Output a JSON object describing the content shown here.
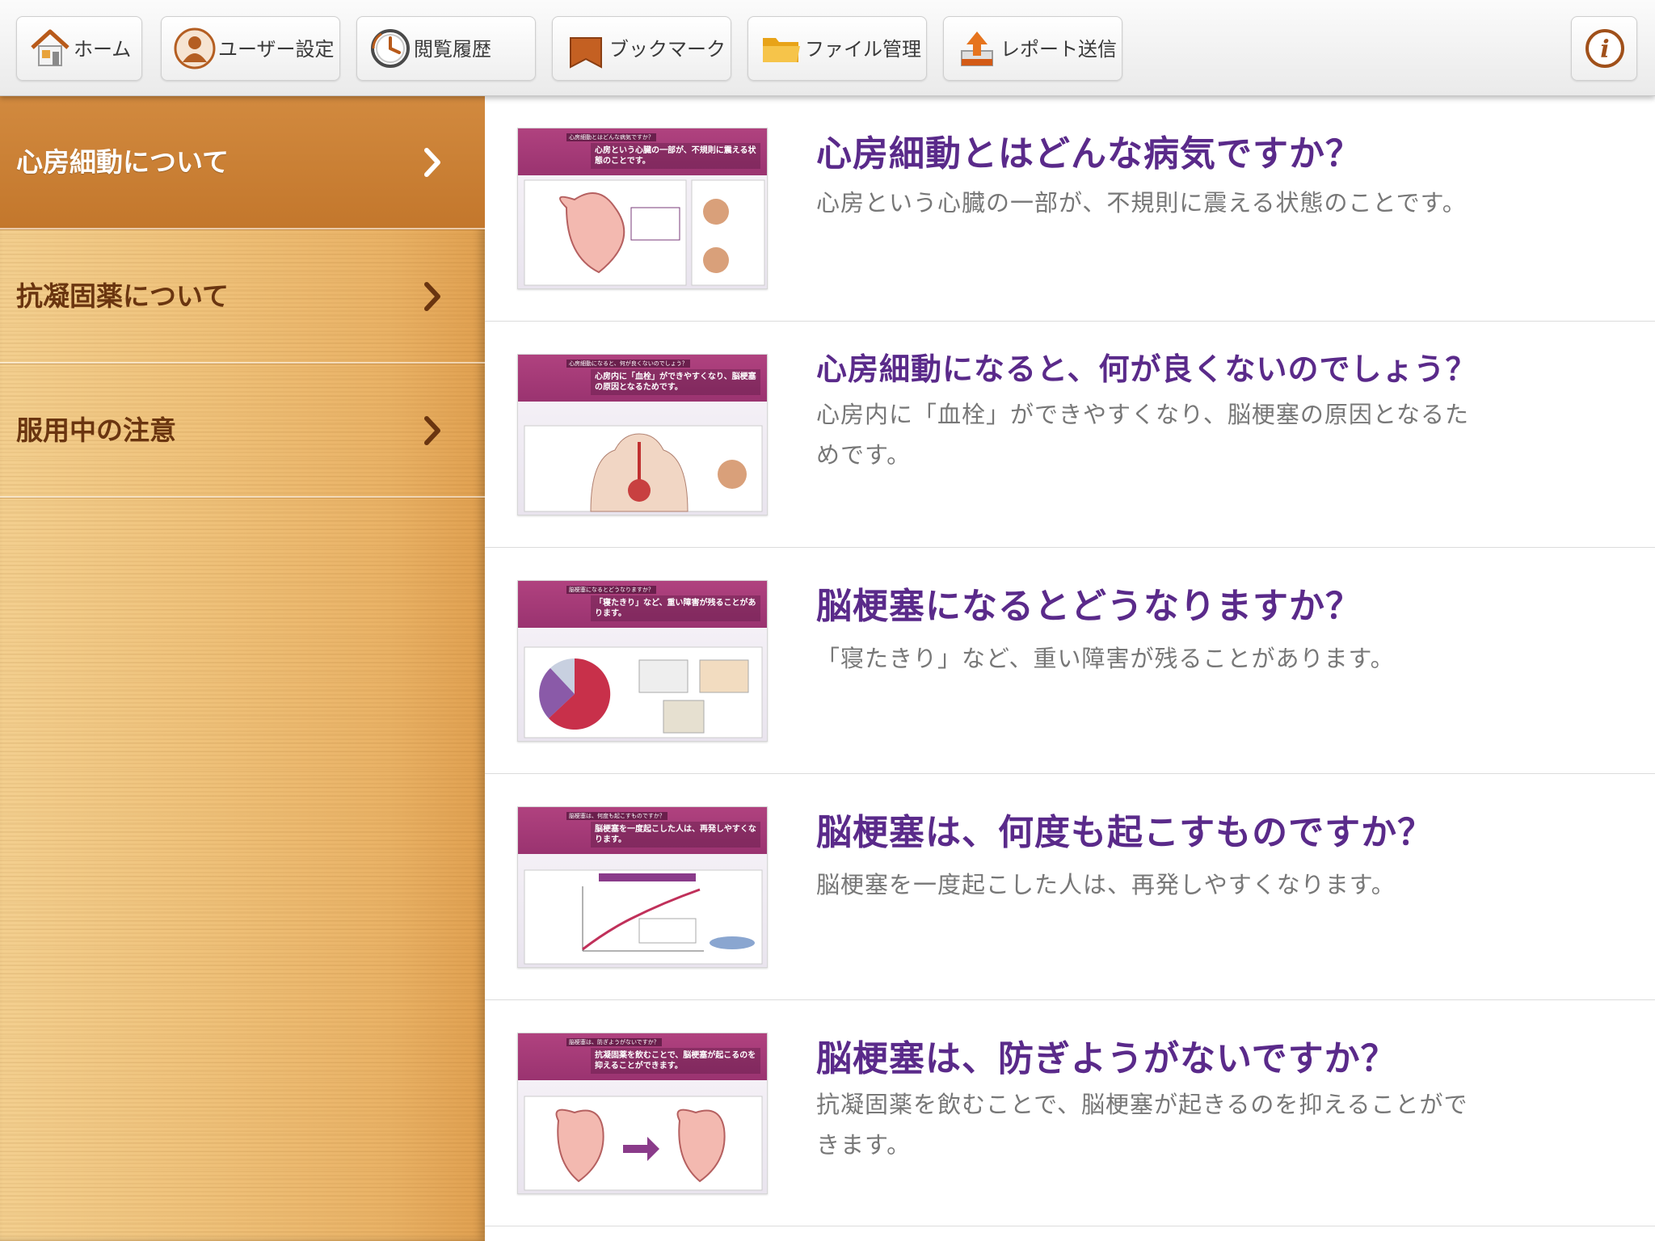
{
  "toolbar": {
    "buttons": [
      {
        "id": "home",
        "label": "ホーム",
        "icon": "home-icon"
      },
      {
        "id": "user",
        "label": "ユーザー設定",
        "icon": "user-icon"
      },
      {
        "id": "history",
        "label": "閲覧履歴",
        "icon": "clock-icon"
      },
      {
        "id": "bookmark",
        "label": "ブックマーク",
        "icon": "bookmark-icon"
      },
      {
        "id": "files",
        "label": "ファイル管理",
        "icon": "folder-icon"
      },
      {
        "id": "report",
        "label": "レポート送信",
        "icon": "upload-icon"
      }
    ],
    "info_icon": "info-icon",
    "info_glyph": "i"
  },
  "sidebar": {
    "items": [
      {
        "label": "心房細動について",
        "active": true
      },
      {
        "label": "抗凝固薬について",
        "active": false
      },
      {
        "label": "服用中の注意",
        "active": false
      }
    ],
    "chevron_icon": "chevron-right-icon"
  },
  "content": {
    "rows": [
      {
        "title": "心房細動とはどんな病気ですか？",
        "description": "心房という心臓の一部が、不規則に震える状態のことです。",
        "thumb_tag": "心房細動とはどんな病気ですか？",
        "thumb_title": "心房という心臓の一部が、不規則に震える状態のことです。"
      },
      {
        "title": "心房細動になると、何が良くないのでしょう？",
        "description": "心房内に「血栓」ができやすくなり、脳梗塞の原因となるためです。",
        "thumb_tag": "心房細動になると、何が良くないのでしょう？",
        "thumb_title": "心房内に「血栓」ができやすくなり、脳梗塞の原因となるためです。"
      },
      {
        "title": "脳梗塞になるとどうなりますか？",
        "description": "「寝たきり」など、重い障害が残ることがあります。",
        "thumb_tag": "脳梗塞になるとどうなりますか？",
        "thumb_title": "「寝たきり」など、重い障害が残ることがあります。"
      },
      {
        "title": "脳梗塞は、何度も起こすものですか？",
        "description": "脳梗塞を一度起こした人は、再発しやすくなります。",
        "thumb_tag": "脳梗塞は、何度も起こすものですか？",
        "thumb_title": "脳梗塞を一度起こした人は、再発しやすくなります。"
      },
      {
        "title": "脳梗塞は、防ぎようがないですか？",
        "description": "抗凝固薬を飲むことで、脳梗塞が起きるのを抑えることができます。",
        "thumb_tag": "脳梗塞は、防ぎようがないですか？",
        "thumb_title": "抗凝固薬を飲むことで、脳梗塞が起こるのを抑えることができます。"
      }
    ]
  },
  "colors": {
    "title_purple": "#5a2a8a",
    "sidebar_active": "#c97f33",
    "sidebar_text": "#6a3510"
  }
}
